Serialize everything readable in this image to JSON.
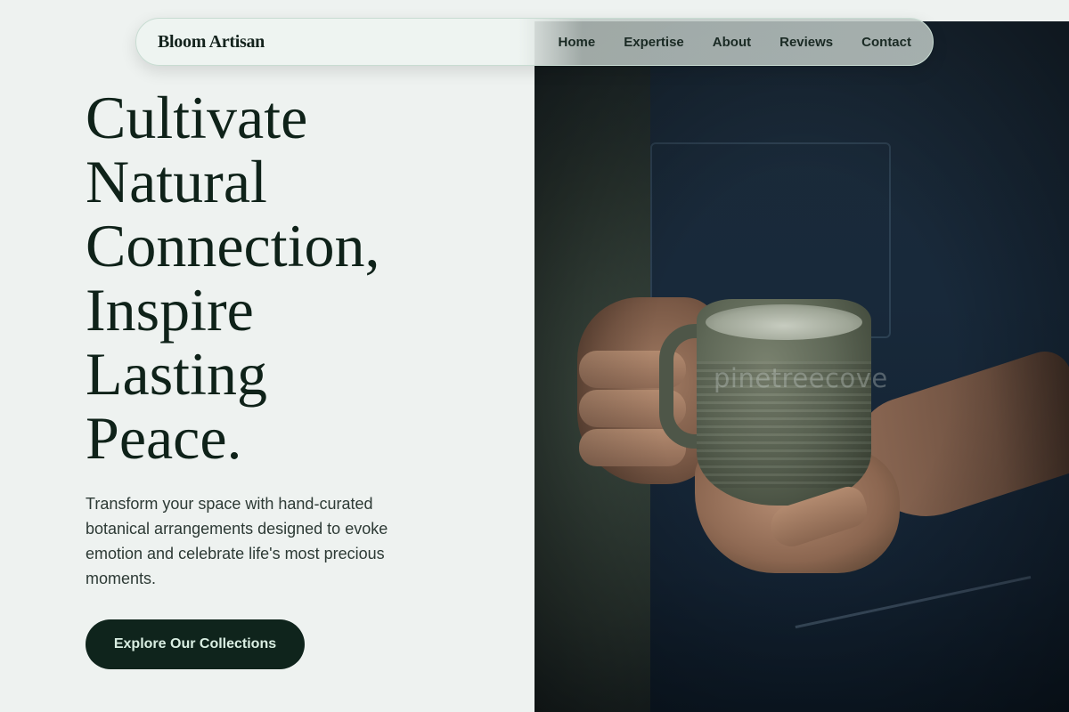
{
  "nav": {
    "brand": "Bloom Artisan",
    "links": [
      "Home",
      "Expertise",
      "About",
      "Reviews",
      "Contact"
    ]
  },
  "hero": {
    "headline_lines": [
      "Cultivate",
      "Natural",
      "Connection,",
      "Inspire",
      "Lasting",
      "Peace."
    ],
    "lede": "Transform your space with hand-curated botanical arrangements designed to evoke emotion and celebrate life's most precious moments.",
    "cta_label": "Explore Our Collections",
    "image_watermark": "pinetreecove"
  },
  "colors": {
    "page_bg": "#eef2f0",
    "ink": "#0f2219",
    "cta_bg": "#0f241c",
    "cta_text": "#d9eee2"
  }
}
